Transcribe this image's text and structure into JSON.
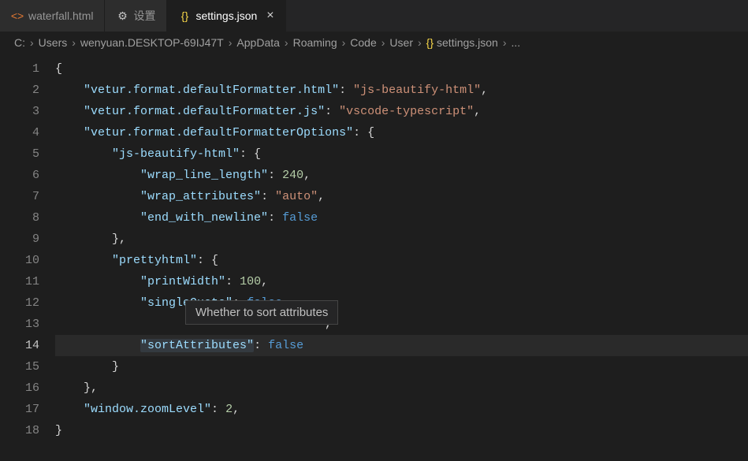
{
  "tabs": [
    {
      "icon": "html",
      "label": "waterfall.html",
      "active": false,
      "close": false
    },
    {
      "icon": "gear",
      "label": "设置",
      "active": false,
      "close": false
    },
    {
      "icon": "json",
      "label": "settings.json",
      "active": true,
      "close": true
    }
  ],
  "breadcrumbs": {
    "items": [
      "C:",
      "Users",
      "wenyuan.DESKTOP-69IJ47T",
      "AppData",
      "Roaming",
      "Code",
      "User",
      "settings.json",
      "..."
    ],
    "lastIcon": "json"
  },
  "tooltip": "Whether to sort attributes",
  "currentLine": 14,
  "codeLines": [
    [
      [
        "p",
        "{"
      ]
    ],
    [
      [
        "p",
        "    "
      ],
      [
        "key",
        "\"vetur.format.defaultFormatter.html\""
      ],
      [
        "p",
        ": "
      ],
      [
        "str",
        "\"js-beautify-html\""
      ],
      [
        "p",
        ","
      ]
    ],
    [
      [
        "p",
        "    "
      ],
      [
        "key",
        "\"vetur.format.defaultFormatter.js\""
      ],
      [
        "p",
        ": "
      ],
      [
        "str",
        "\"vscode-typescript\""
      ],
      [
        "p",
        ","
      ]
    ],
    [
      [
        "p",
        "    "
      ],
      [
        "key",
        "\"vetur.format.defaultFormatterOptions\""
      ],
      [
        "p",
        ": {"
      ]
    ],
    [
      [
        "p",
        "        "
      ],
      [
        "key",
        "\"js-beautify-html\""
      ],
      [
        "p",
        ": {"
      ]
    ],
    [
      [
        "p",
        "            "
      ],
      [
        "key",
        "\"wrap_line_length\""
      ],
      [
        "p",
        ": "
      ],
      [
        "num",
        "240"
      ],
      [
        "p",
        ","
      ]
    ],
    [
      [
        "p",
        "            "
      ],
      [
        "key",
        "\"wrap_attributes\""
      ],
      [
        "p",
        ": "
      ],
      [
        "str",
        "\"auto\""
      ],
      [
        "p",
        ","
      ]
    ],
    [
      [
        "p",
        "            "
      ],
      [
        "key",
        "\"end_with_newline\""
      ],
      [
        "p",
        ": "
      ],
      [
        "bool",
        "false"
      ]
    ],
    [
      [
        "p",
        "        },"
      ]
    ],
    [
      [
        "p",
        "        "
      ],
      [
        "key",
        "\"prettyhtml\""
      ],
      [
        "p",
        ": {"
      ]
    ],
    [
      [
        "p",
        "            "
      ],
      [
        "key",
        "\"printWidth\""
      ],
      [
        "p",
        ": "
      ],
      [
        "num",
        "100"
      ],
      [
        "p",
        ","
      ]
    ],
    [
      [
        "p",
        "            "
      ],
      [
        "key",
        "\"singleQuote\""
      ],
      [
        "p",
        ": "
      ],
      [
        "bool",
        "false"
      ],
      [
        "p",
        ","
      ]
    ],
    [
      [
        "p",
        "                                      ,"
      ]
    ],
    [
      [
        "p",
        "            "
      ],
      [
        "keyhl",
        "\"sortAttributes\""
      ],
      [
        "p",
        ": "
      ],
      [
        "bool",
        "false"
      ]
    ],
    [
      [
        "p",
        "        }"
      ]
    ],
    [
      [
        "p",
        "    },"
      ]
    ],
    [
      [
        "p",
        "    "
      ],
      [
        "key",
        "\"window.zoomLevel\""
      ],
      [
        "p",
        ": "
      ],
      [
        "num",
        "2"
      ],
      [
        "p",
        ","
      ]
    ],
    [
      [
        "p",
        "}"
      ]
    ]
  ],
  "icons": {
    "html": "<>",
    "gear": "⚙",
    "json": "{}",
    "close": "×",
    "sep": "›"
  }
}
